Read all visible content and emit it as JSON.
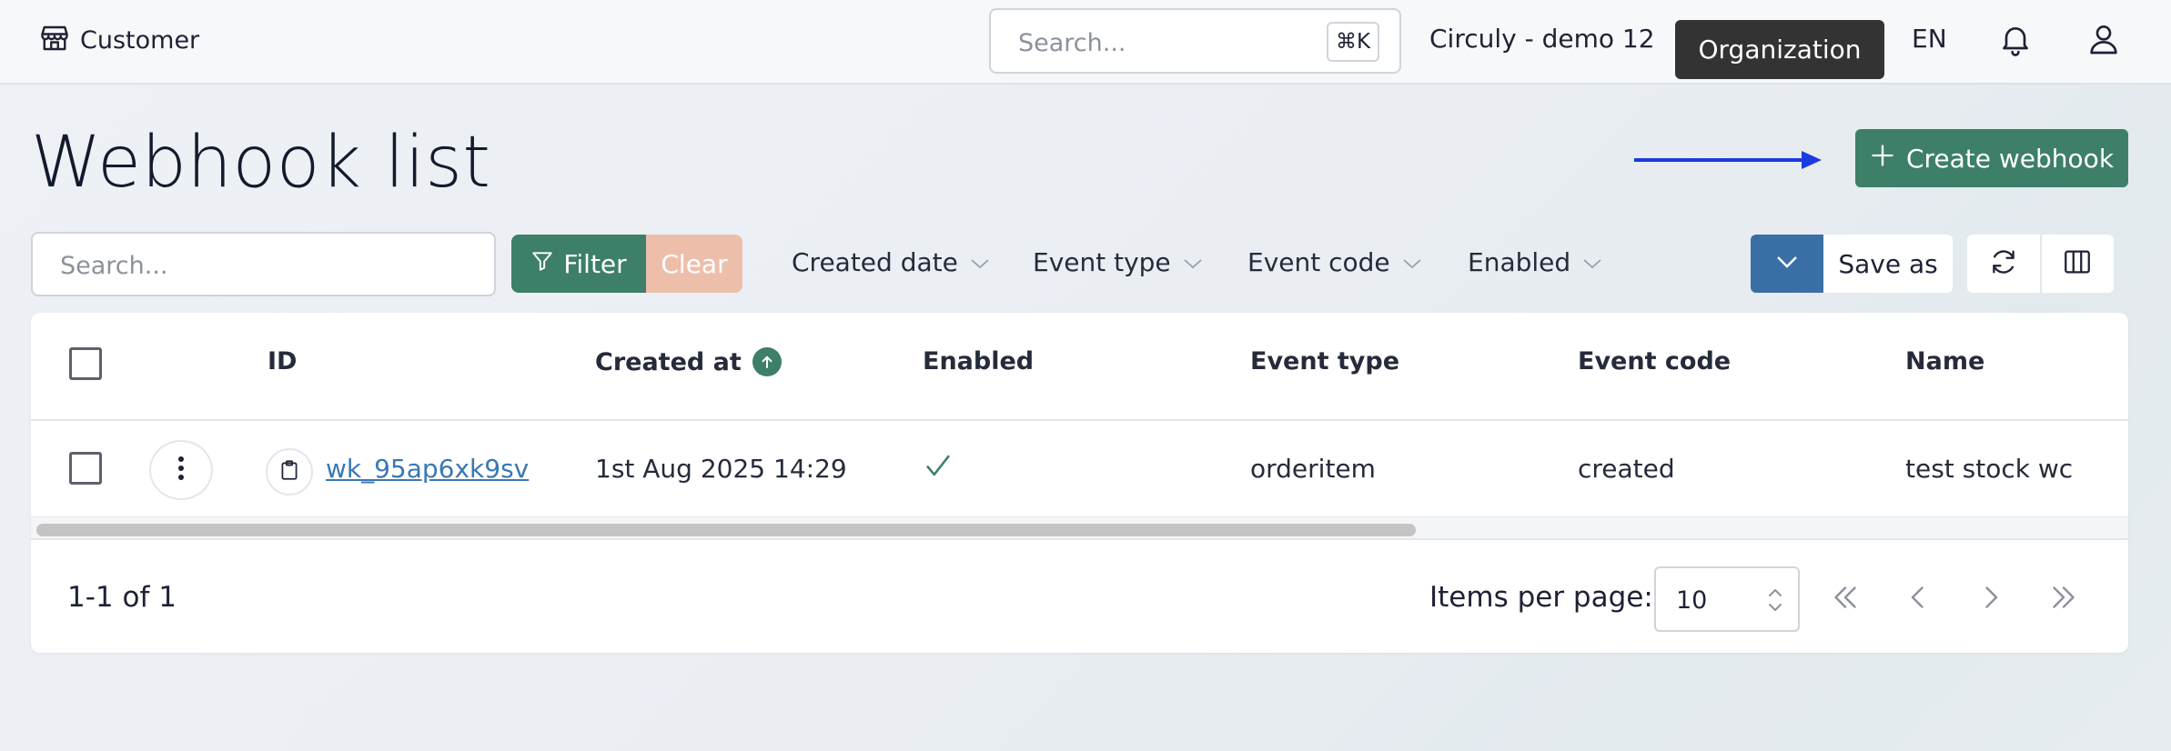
{
  "topbar": {
    "brand_label": "Customer",
    "search_placeholder": "Search...",
    "search_shortcut": "⌘K",
    "workspace_name": "Circuly - demo 12",
    "organization_label": "Organization",
    "language": "EN"
  },
  "page": {
    "title": "Webhook list",
    "create_button_label": "Create webhook"
  },
  "filters": {
    "search_placeholder": "Search...",
    "filter_label": "Filter",
    "clear_label": "Clear",
    "dropdowns": [
      "Created date",
      "Event type",
      "Event code",
      "Enabled"
    ],
    "save_as_label": "Save as"
  },
  "table": {
    "columns": [
      "ID",
      "Created at",
      "Enabled",
      "Event type",
      "Event code",
      "Name"
    ],
    "rows": [
      {
        "id": "wk_95ap6xk9sv",
        "created_at": "1st Aug 2025 14:29",
        "enabled": true,
        "event_type": "orderitem",
        "event_code": "created",
        "name": "test stock wc"
      }
    ]
  },
  "pagination": {
    "range_text": "1-1 of 1",
    "items_per_page_label": "Items per page:",
    "items_per_page_value": "10"
  },
  "colors": {
    "primary_green": "#3d7f68",
    "clear_peach": "#edbfab",
    "view_blue": "#3a6fa5",
    "link_blue": "#3a78b5",
    "arrow_blue": "#1a3be0",
    "org_dark": "#333333"
  }
}
